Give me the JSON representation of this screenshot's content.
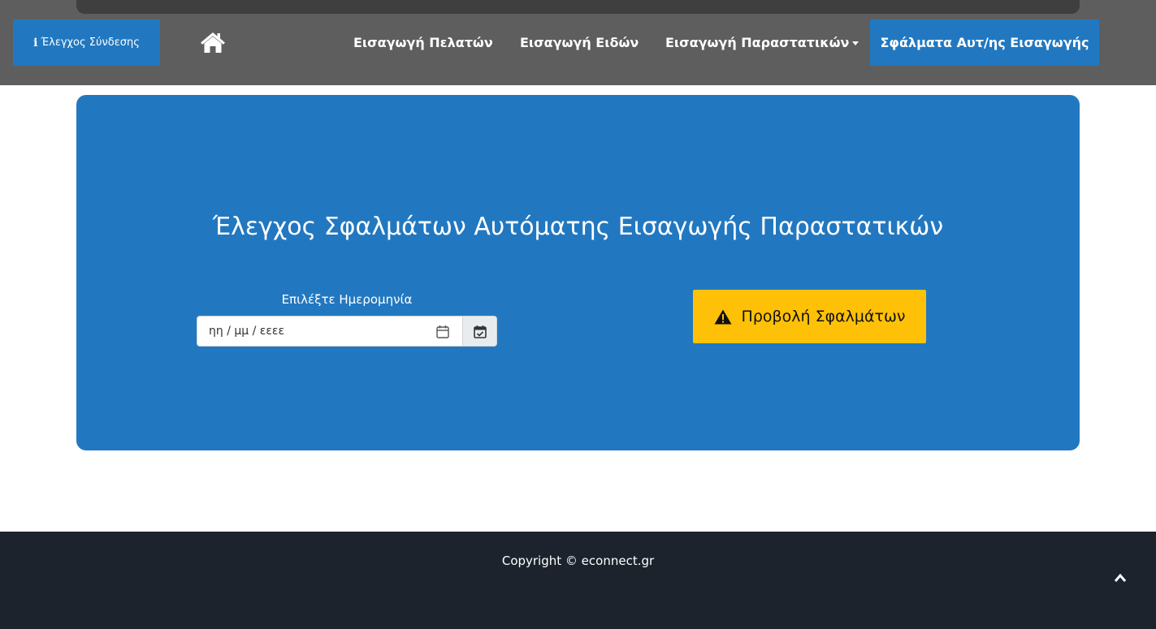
{
  "navbar": {
    "connection_check_label": "Έλεγχος Σύνδεσης",
    "info_icon_glyph": "i",
    "home_icon": "home-icon",
    "links": {
      "customers": "Εισαγωγή Πελατών",
      "items": "Εισαγωγή Ειδών",
      "documents": "Εισαγωγή Παραστατικών",
      "auto_import_errors": "Σφάλματα Αυτ/ης Εισαγωγής"
    },
    "accent_color": "#2278c0",
    "background_color": "#5e5e5e"
  },
  "main": {
    "title": "Έλεγχος Σφαλμάτων Αυτόματης Εισαγωγής Παραστατικών",
    "date_label": "Επιλέξτε Ημερομηνία",
    "date_placeholder": "ηη / μμ / εεεε",
    "show_errors_button": "Προβολή Σφαλμάτων",
    "panel_color": "#2278c0",
    "button_color": "#ffc107"
  },
  "footer": {
    "copyright": "Copyright © econnect.gr",
    "back_to_top_icon": "chevron-up-icon",
    "background_color": "#1c232d"
  }
}
